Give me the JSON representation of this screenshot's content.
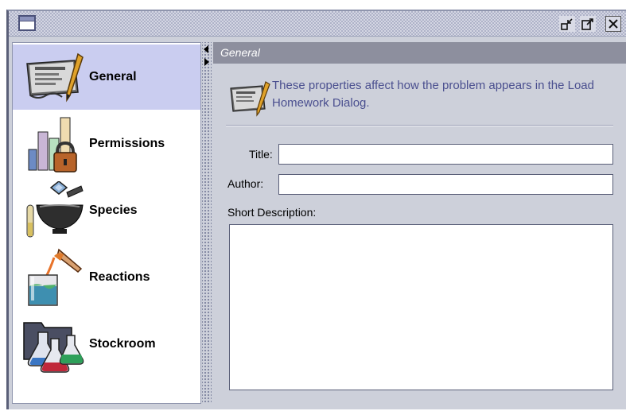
{
  "window": {
    "controls": {
      "restore_icon": "restore-icon",
      "maximize_icon": "maximize-icon",
      "close_icon": "close-icon"
    }
  },
  "sidebar": {
    "items": [
      {
        "label": "General",
        "icon": "certificate-pen-icon",
        "selected": true
      },
      {
        "label": "Permissions",
        "icon": "bar-chart-lock-icon",
        "selected": false
      },
      {
        "label": "Species",
        "icon": "mortar-pestle-icon",
        "selected": false
      },
      {
        "label": "Reactions",
        "icon": "beaker-pour-icon",
        "selected": false
      },
      {
        "label": "Stockroom",
        "icon": "flasks-folder-icon",
        "selected": false
      }
    ]
  },
  "panel": {
    "header": "General",
    "info_text": "These properties affect how the problem appears in the Load Homework Dialog.",
    "fields": {
      "title_label": "Title:",
      "title_value": "",
      "author_label": "Author:",
      "author_value": "",
      "description_label": "Short Description:",
      "description_value": ""
    }
  },
  "colors": {
    "selected_bg": "#cacdf0",
    "header_bg": "#8d8f9e",
    "info_text": "#4a4f8f",
    "panel_bg": "#cdd0da"
  }
}
